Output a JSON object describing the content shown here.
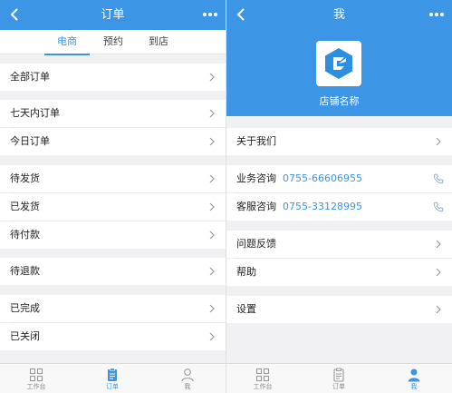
{
  "colors": {
    "accent": "#3d95e6",
    "background": "#f1f1f3",
    "card": "#ffffff",
    "divider": "#e8e8e8",
    "inactive_icon": "#9a9a9a"
  },
  "orders_screen": {
    "navbar": {
      "title": "订单",
      "back_icon": "chevron-left-icon",
      "more_icon": "more-dots-icon"
    },
    "tabs": [
      {
        "label": "电商",
        "active": true
      },
      {
        "label": "预约",
        "active": false
      },
      {
        "label": "到店",
        "active": false
      }
    ],
    "rows": [
      {
        "label": "全部订单"
      },
      {
        "label": "七天内订单"
      },
      {
        "label": "今日订单"
      },
      {
        "label": "待发货"
      },
      {
        "label": "已发货"
      },
      {
        "label": "待付款"
      },
      {
        "label": "待退款"
      },
      {
        "label": "已完成"
      },
      {
        "label": "已关闭"
      }
    ]
  },
  "profile_screen": {
    "navbar": {
      "title": "我",
      "back_icon": "chevron-left-icon",
      "more_icon": "more-dots-icon"
    },
    "store_name": "店铺名称",
    "rows": [
      {
        "label": "关于我们"
      },
      {
        "label": "业务咨询",
        "value": "0755-66606955",
        "icon": "phone-icon"
      },
      {
        "label": "客服咨询",
        "value": "0755-33128995",
        "icon": "phone-icon"
      },
      {
        "label": "问题反馈"
      },
      {
        "label": "帮助"
      },
      {
        "label": "设置"
      }
    ]
  },
  "tabbar": {
    "items": [
      {
        "label": "工作台",
        "icon": "grid-icon"
      },
      {
        "label": "订单",
        "icon": "clipboard-icon"
      },
      {
        "label": "我",
        "icon": "person-icon"
      }
    ],
    "orders_active_index": 1,
    "profile_active_index": 2
  }
}
